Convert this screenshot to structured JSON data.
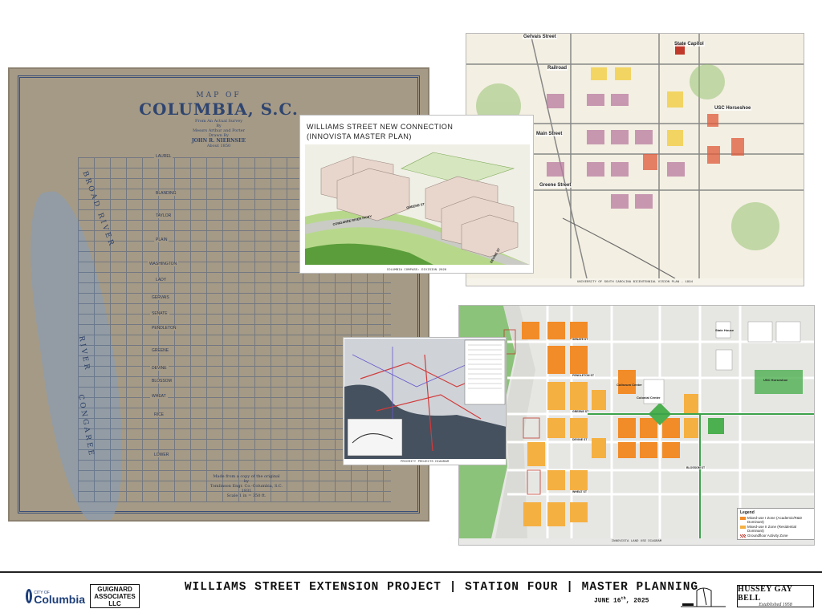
{
  "historic_map": {
    "title_top": "MAP OF",
    "title_main": "COLUMBIA, S.C.",
    "subtitle_1": "From An Actual Survey",
    "subtitle_2": "By",
    "subtitle_3": "Messrs Arthur and Porter",
    "subtitle_4": "Drawn By",
    "subtitle_5": "JOHN R. NIERNSEE",
    "subtitle_6": "About 1850",
    "streets": [
      "LAUREL",
      "BLANDING",
      "TAYLOR",
      "PLAIN",
      "WASHINGTON",
      "LADY",
      "GERVAIS",
      "SENATE",
      "PENDLETON",
      "GREENE",
      "DEVINE",
      "BLOSSOM",
      "WHEAT",
      "RICE",
      "LOWER"
    ],
    "river_label_1": "BROAD RIVER",
    "river_label_2": "RIVER",
    "river_label_3": "CONGAREE",
    "credit_1": "Made from a copy of the original",
    "credit_2": "by",
    "credit_3": "Tomlinson Engr. Co.-Columbia, S.C.",
    "credit_4": "1931",
    "credit_5": "Scale 1 in = 350 ft."
  },
  "innovista": {
    "heading_1": "WILLIAMS STREET NEW CONNECTION",
    "heading_2": "(INNOVISTA MASTER PLAN)",
    "street_1": "CONGAREE RIVER PKWY",
    "street_2": "GREENE ST",
    "street_3": "DEVINE ST",
    "caption": "COLUMBIA COMPASS: DIVISION 2026"
  },
  "usc_plan": {
    "labels": [
      "Gervais Street",
      "State Capitol",
      "Railroad",
      "USC Horseshoe",
      "Main Street",
      "Greene Street"
    ],
    "caption": "UNIVERSITY OF SOUTH CAROLINA BICENTENNIAL VISION PLAN - 1994"
  },
  "landuse": {
    "labels": [
      "State House",
      "Coliseum Center",
      "Colonial Center",
      "USC Horseshoe",
      "SENATE ST",
      "PENDLETON ST",
      "GREENE ST",
      "DEVINE ST",
      "BLOSSOM ST",
      "WHEAT ST"
    ],
    "legend_title": "Legend",
    "legend": [
      {
        "label": "Mixed-use I Zone (Academic/R&D Dominant)",
        "color": "#f28c28"
      },
      {
        "label": "Mixed-use II Zone (Residential Dominant)",
        "color": "#f5b042"
      },
      {
        "label": "Groundfloor Activity Zone",
        "color": "#c0392b"
      }
    ],
    "caption": "INNOVISTA LAND USE DIAGRAM"
  },
  "priority": {
    "caption": "PRIORITY PROJECTS DIAGRAM"
  },
  "titlebar": {
    "columbia_small": "CITY OF",
    "columbia_name": "Columbia",
    "guignard_1": "GUIGNARD",
    "guignard_2": "ASSOCIATES",
    "guignard_3": "LLC",
    "title": "WILLIAMS STREET EXTENSION PROJECT | STATION FOUR | MASTER PLANNING",
    "date_pre": "JUNE 16",
    "date_sup": "th",
    "date_post": ", 2025",
    "hgb_name": "HUSSEY GAY BELL",
    "hgb_est": "Established 1958"
  },
  "colors": {
    "map_paper": "#a59a86",
    "map_ink": "#2f4570",
    "mixed_use_1": "#f28c28",
    "mixed_use_2": "#f5b042",
    "green": "#4caf50"
  }
}
